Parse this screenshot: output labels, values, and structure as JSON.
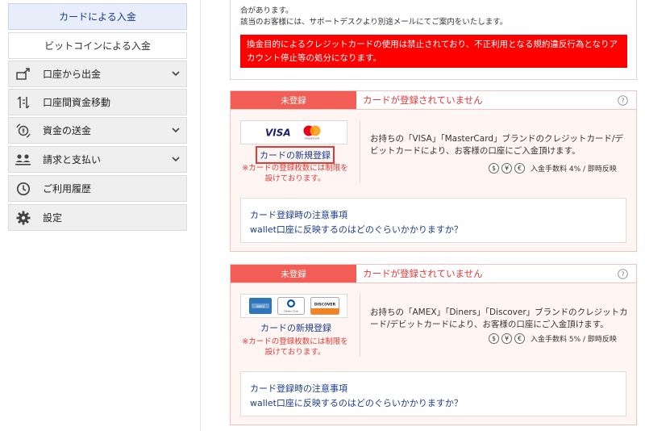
{
  "sidebar": {
    "sub_items": [
      {
        "label": "カードによる入金"
      },
      {
        "label": "ビットコインによる入金"
      }
    ],
    "items": [
      {
        "label": "口座から出金",
        "icon": "withdraw-icon"
      },
      {
        "label": "口座間資金移動",
        "icon": "transfer-icon"
      },
      {
        "label": "資金の送金",
        "icon": "send-money-icon"
      },
      {
        "label": "請求と支払い",
        "icon": "users-icon"
      },
      {
        "label": "ご利用履歴",
        "icon": "history-icon"
      },
      {
        "label": "設定",
        "icon": "gear-icon"
      }
    ]
  },
  "notice": {
    "line1": "合があります。",
    "line2": "該当のお客様には、サポートデスクより別途メールにてご案内をいたします。",
    "warning": "換金目的によるクレジットカードの使用は禁止されており、不正利用となる規約違反行為となりアカウント停止等の処分になります。"
  },
  "cards": [
    {
      "status": "未登録",
      "header_text": "カードが登録されていません",
      "brands": [
        "VISA",
        "mastercard"
      ],
      "register_label": "カードの新規登録",
      "note": "※カードの登録枚数には制限を設けております。",
      "description": "お持ちの「VISA」「MasterCard」ブランドのクレジットカード/デビットカードにより、お客様の口座にご入金頂けます。",
      "fee": "入金手数料 4% / 即時反映",
      "faq": [
        "カード登録時の注意事項",
        "wallet口座に反映するのはどのぐらいかかりますか？"
      ]
    },
    {
      "status": "未登録",
      "header_text": "カードが登録されていません",
      "brands": [
        "AMEX",
        "Diners Club",
        "DISCOVER"
      ],
      "register_label": "カードの新規登録",
      "note": "※カードの登録枚数には制限を設けております。",
      "description": "お持ちの「AMEX」「Diners」「Discover」ブランドのクレジットカード/デビットカードにより、お客様の口座にご入金頂けます。",
      "fee": "入金手数料 5% / 即時反映",
      "faq": [
        "カード登録時の注意事項",
        "wallet口座に反映するのはどのぐらいかかりますか？"
      ]
    }
  ],
  "currency_symbols": [
    "$",
    "¥",
    "€"
  ],
  "colors": {
    "status_red": "#f25e55",
    "warning_red": "#ff0000",
    "link_blue": "#1a3d8f",
    "active_bg": "#e8eef9"
  }
}
